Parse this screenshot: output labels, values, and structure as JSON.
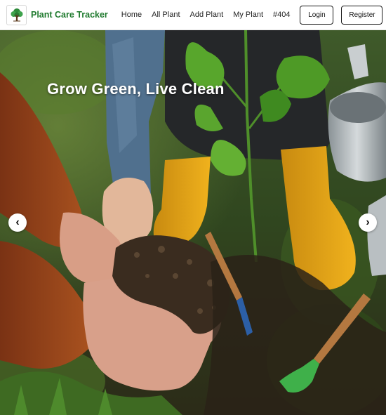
{
  "brand": {
    "name": "Plant Care Tracker",
    "logo_icon": "tree-icon",
    "color": "#1f7a2e"
  },
  "nav": {
    "links": [
      {
        "label": "Home"
      },
      {
        "label": "All Plant"
      },
      {
        "label": "Add Plant"
      },
      {
        "label": "My Plant"
      },
      {
        "label": "#404"
      }
    ],
    "login_label": "Login",
    "register_label": "Register"
  },
  "hero": {
    "title": "Grow Green, Live Clean",
    "prev_icon": "chevron-left-icon",
    "next_icon": "chevron-right-icon",
    "prev_glyph": "‹",
    "next_glyph": "›"
  }
}
